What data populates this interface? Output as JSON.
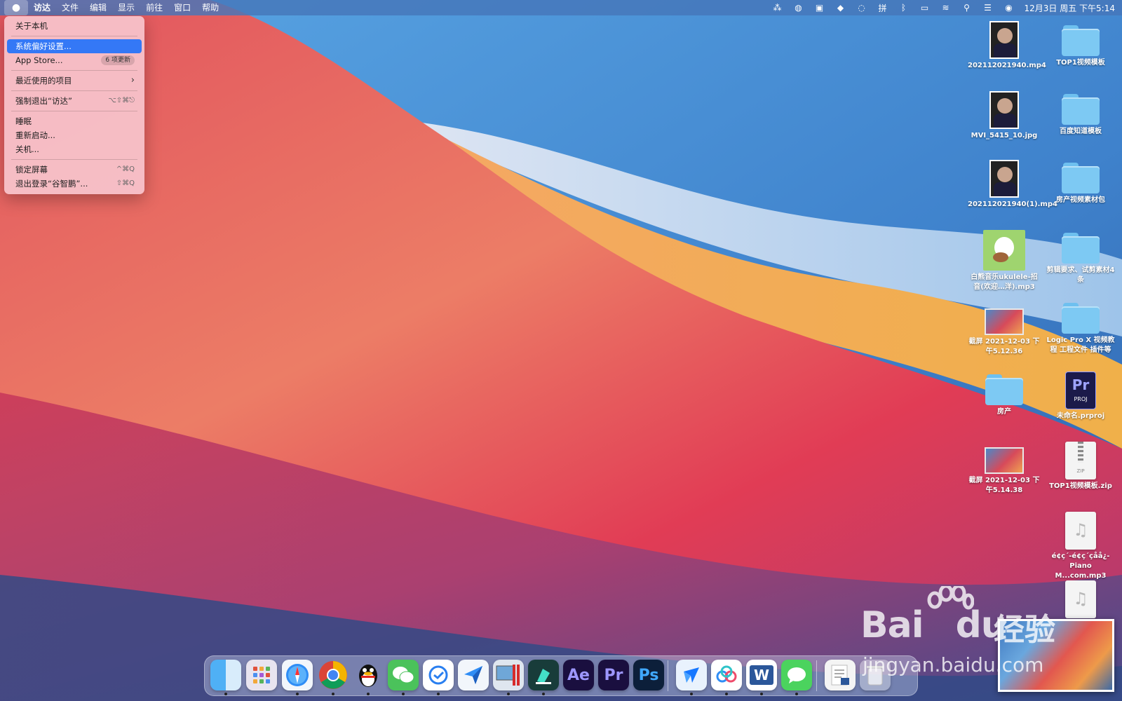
{
  "menubar": {
    "apple": "",
    "app_name": "访达",
    "menus": [
      "文件",
      "编辑",
      "显示",
      "前往",
      "窗口",
      "帮助"
    ],
    "clock": "12月3日 周五 下午5:14"
  },
  "apple_menu": {
    "about": "关于本机",
    "system_prefs": "系统偏好设置...",
    "app_store": "App Store...",
    "app_store_badge": "6 项更新",
    "recent_items": "最近使用的项目",
    "force_quit": "强制退出“访达”",
    "force_quit_shortcut": "⌥⇧⌘⎋",
    "sleep": "睡眠",
    "restart": "重新启动...",
    "shutdown": "关机...",
    "lock_screen": "锁定屏幕",
    "lock_shortcut": "^⌘Q",
    "logout": "退出登录“谷智鹏”...",
    "logout_shortcut": "⇧⌘Q"
  },
  "desktop": {
    "items": [
      {
        "label": "202112021940.mp4"
      },
      {
        "label": "TOP1视频模板"
      },
      {
        "label": "MVI_5415_10.jpg"
      },
      {
        "label": "百度知道模板"
      },
      {
        "label": "202112021940(1).mp4"
      },
      {
        "label": "房产视频素材包"
      },
      {
        "label": "白熊音乐ukulele-招音(欢迎…洋).mp3"
      },
      {
        "label": "剪辑要求、试剪素材4条"
      },
      {
        "label": "截屏 2021-12-03 下午5.12.36"
      },
      {
        "label": "Logic Pro X 视频教程 工程文件 插件等"
      },
      {
        "label": "房产"
      },
      {
        "label": "未命名.prproj"
      },
      {
        "label": "截屏 2021-12-03 下午5.14.38"
      },
      {
        "label": "TOP1视频模板.zip"
      },
      {
        "label": "é¢ç´-é¢ç´çåå¿-Piano M...com.mp3"
      }
    ],
    "pr_icon_text": "Pr",
    "pr_icon_sub": "PROJ",
    "zip_tag": "ZIP"
  },
  "dock": {
    "ae": "Ae",
    "pr": "Pr",
    "ps": "Ps",
    "word": "W"
  },
  "watermark": {
    "brand": "Bai",
    "brand2": "du",
    "cn": "经验",
    "url": "jingyan.baidu.com"
  },
  "colors": {
    "menu_highlight": "#3478f6",
    "menubar": "#4676ba",
    "folder": "#7dc9f3"
  }
}
